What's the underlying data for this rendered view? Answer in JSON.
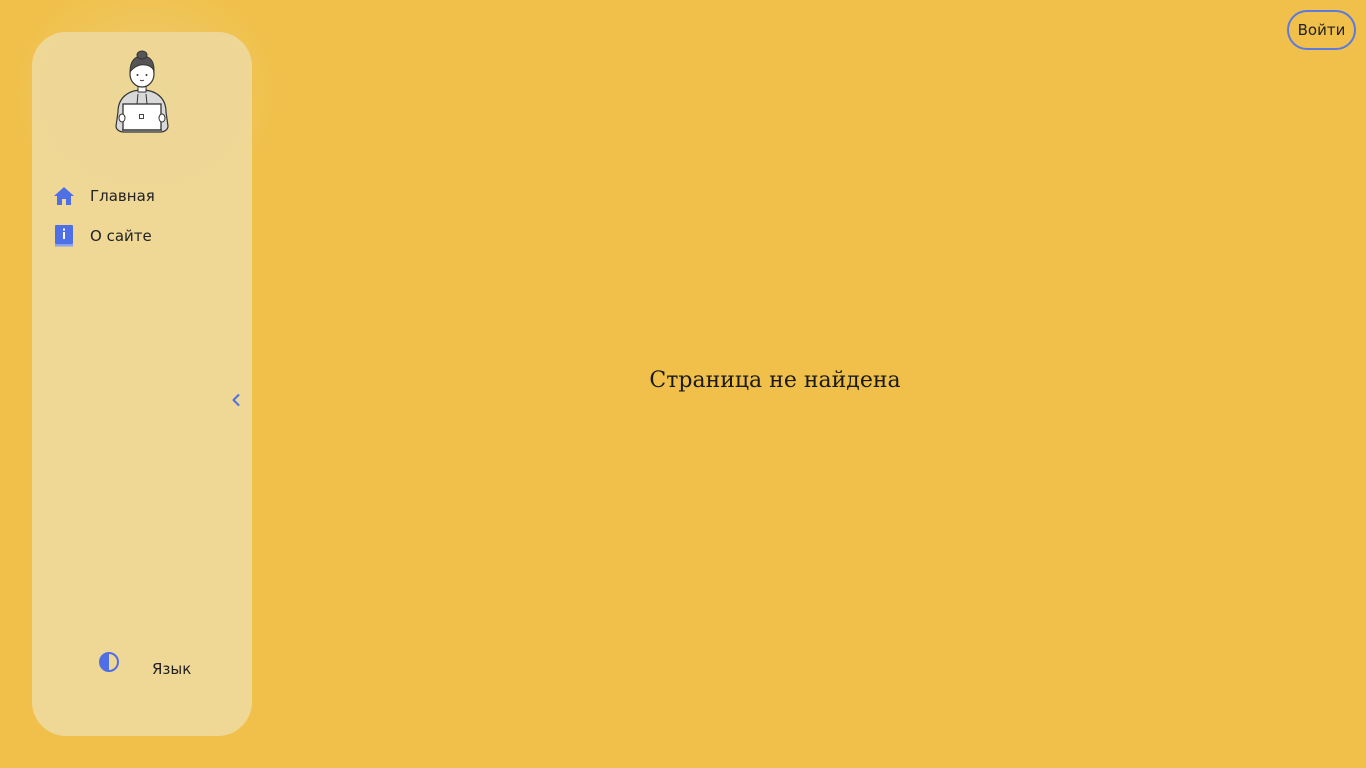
{
  "sidebar": {
    "items": [
      {
        "label": "Главная",
        "icon": "home-icon"
      },
      {
        "label": "О сайте",
        "icon": "info-book-icon"
      }
    ],
    "collapse_icon": "chevron-left-icon",
    "theme_icon": "contrast-icon",
    "language_label": "Язык"
  },
  "header": {
    "login_label": "Войти"
  },
  "main": {
    "message": "Страница не найдена"
  },
  "colors": {
    "background": "#f0c04a",
    "sidebar": "#efd796",
    "accent": "#4f6fe6"
  }
}
